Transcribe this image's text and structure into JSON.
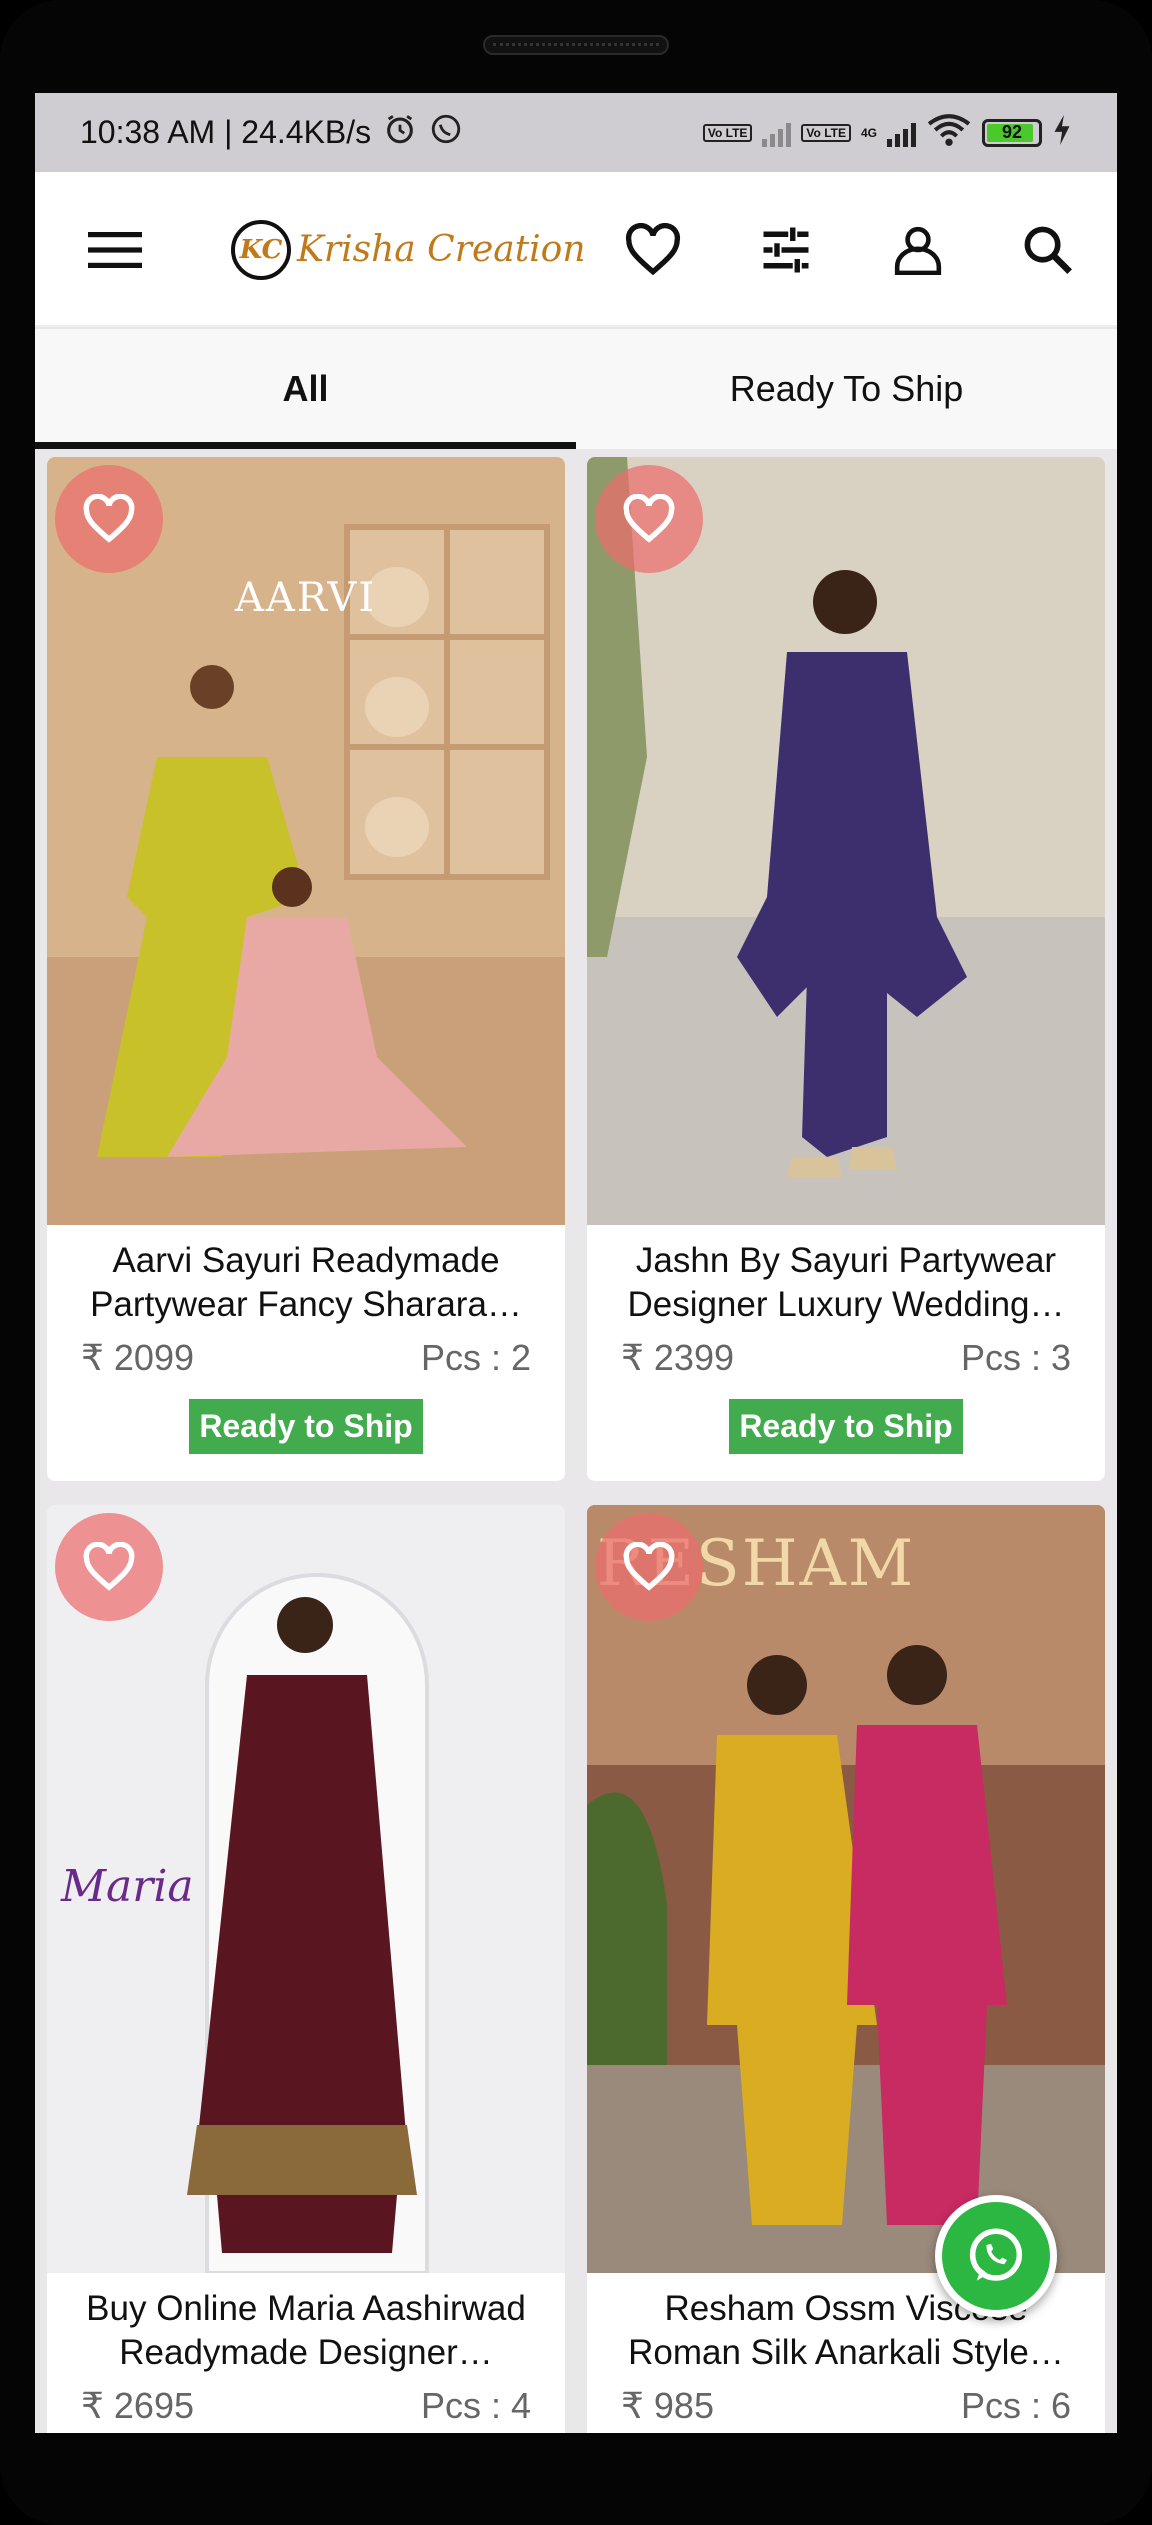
{
  "status_bar": {
    "time": "10:38 AM | 24.4KB/s",
    "battery": "92",
    "network": "4G",
    "volte": "Vo LTE"
  },
  "app_bar": {
    "brand_mark": "KC",
    "brand_name": "Krisha Creation"
  },
  "tabs": [
    {
      "label": "All"
    },
    {
      "label": "Ready To Ship"
    }
  ],
  "products": [
    {
      "title": "Aarvi Sayuri Readymade Partywear Fancy Sharara…",
      "price": "₹ 2099",
      "pcs": "Pcs : 2",
      "badge": "Ready to Ship",
      "brand_overlay": "AARVI"
    },
    {
      "title": "Jashn By Sayuri Partywear Designer Luxury Wedding…",
      "price": "₹ 2399",
      "pcs": "Pcs : 3",
      "badge": "Ready to Ship",
      "brand_overlay": ""
    },
    {
      "title": "Buy Online Maria Aashirwad Readymade Designer…",
      "price": "₹ 2695",
      "pcs": "Pcs : 4",
      "badge": "",
      "brand_overlay": "Maria"
    },
    {
      "title": "Resham Ossm Viscose Roman Silk Anarkali Style…",
      "price": "₹ 985",
      "pcs": "Pcs : 6",
      "badge": "",
      "brand_overlay": "RESHAM"
    }
  ],
  "colors": {
    "accent_gold": "#c07a1a",
    "ready_badge": "#41ab4d",
    "favorite_bg": "#eb6e6e",
    "whatsapp": "#2bb741"
  },
  "icons": [
    "menu-icon",
    "heart-icon",
    "filter-icon",
    "user-icon",
    "search-icon",
    "whatsapp-icon",
    "alarm-icon",
    "wifi-icon"
  ]
}
